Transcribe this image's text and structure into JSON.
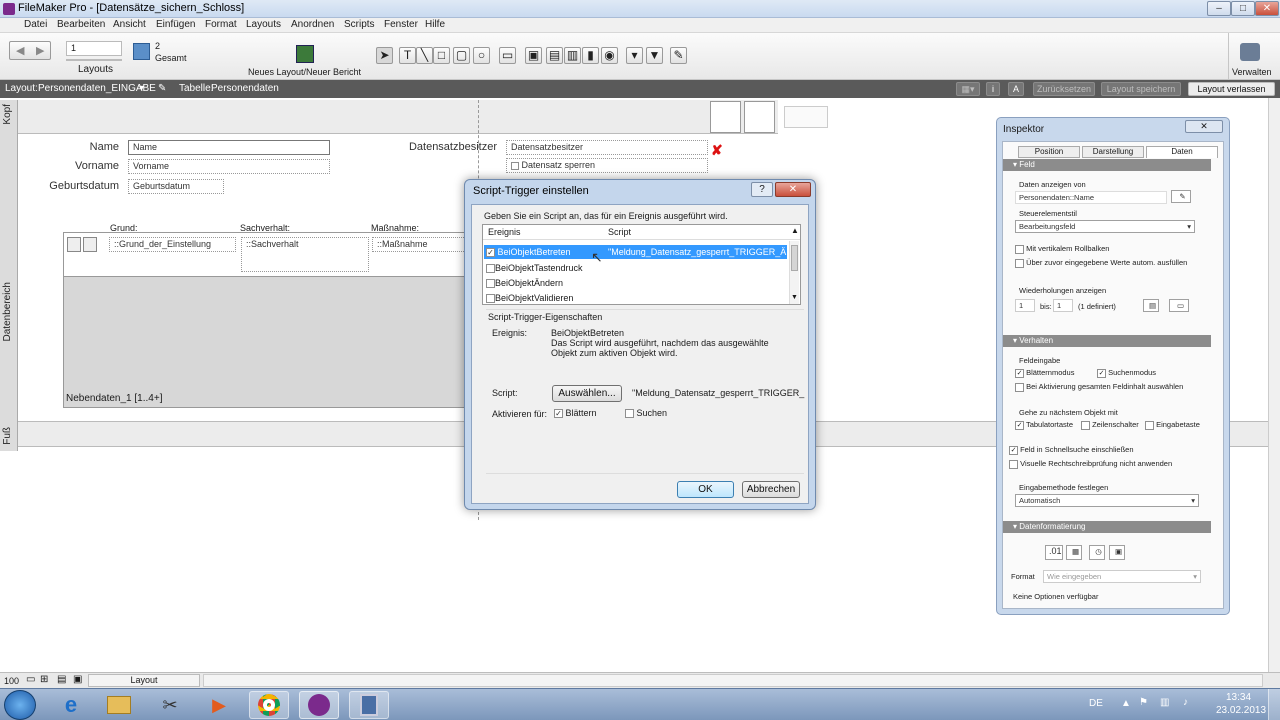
{
  "window": {
    "title": "FileMaker Pro - [Datensätze_sichern_Schloss]"
  },
  "menu": [
    "Datei",
    "Bearbeiten",
    "Ansicht",
    "Einfügen",
    "Format",
    "Layouts",
    "Anordnen",
    "Scripts",
    "Fenster",
    "Hilfe"
  ],
  "toolbar": {
    "record_number": "1",
    "total_count": "2",
    "total_label": "Gesamt",
    "layouts_label": "Layouts",
    "new_layout_label": "Neues Layout/Neuer Bericht",
    "manage_label": "Verwalten"
  },
  "layoutbar": {
    "layout_label": "Layout:",
    "layout_value": "Personendaten_EINGABE",
    "table_label": "Tabelle:",
    "table_value": "Personendaten",
    "reset_label": "Zurücksetzen",
    "save_label": "Layout speichern",
    "exit_label": "Layout verlassen"
  },
  "layout": {
    "bands": {
      "header": "Kopf",
      "body": "Datenbereich",
      "footer": "Fuß"
    },
    "labels": {
      "name": "Name",
      "vorname": "Vorname",
      "geburtsdatum": "Geburtsdatum",
      "besitzer": "Datensatzbesitzer",
      "grund": "Grund:",
      "sachverhalt": "Sachverhalt:",
      "massnahme": "Maßnahme:"
    },
    "fields": {
      "name": "Name",
      "vorname": "Vorname",
      "geburtsdatum": "Geburtsdatum",
      "besitzer": "Datensatzbesitzer",
      "sperren": "Datensatz sperren",
      "grund": "::Grund_der_Einstellung",
      "sachverhalt": "::Sachverhalt",
      "massnahme": "::Maßnahme"
    },
    "portal_label": "Nebendaten_1 [1..4+]"
  },
  "dialog": {
    "title": "Script-Trigger einstellen",
    "instruction": "Geben Sie ein Script an, das für ein Ereignis ausgeführt wird.",
    "col_event": "Ereignis",
    "col_script": "Script",
    "events": [
      {
        "name": "BeiObjektBetreten",
        "checked": true,
        "selected": true,
        "script": "\"Meldung_Datensatz_gesperrt_TRIGGER_Ä..."
      },
      {
        "name": "BeiObjektTastendruck",
        "checked": false,
        "selected": false,
        "script": ""
      },
      {
        "name": "BeiObjektÄndern",
        "checked": false,
        "selected": false,
        "script": ""
      },
      {
        "name": "BeiObjektValidieren",
        "checked": false,
        "selected": false,
        "script": ""
      }
    ],
    "props_title": "Script-Trigger-Eigenschaften",
    "event_label": "Ereignis:",
    "event_name": "BeiObjektBetreten",
    "event_desc_1": "Das Script wird ausgeführt, nachdem das ausgewählte",
    "event_desc_2": "Objekt zum aktiven Objekt wird.",
    "script_label": "Script:",
    "choose_button": "Auswählen...",
    "script_value": "\"Meldung_Datensatz_gesperrt_TRIGGER_",
    "activate_label": "Aktivieren für:",
    "browse_label": "Blättern",
    "browse_checked": true,
    "find_label": "Suchen",
    "find_checked": false,
    "ok": "OK",
    "cancel": "Abbrechen"
  },
  "inspector": {
    "title": "Inspektor",
    "tabs": [
      "Position",
      "Darstellung",
      "Daten"
    ],
    "sec_field": "Feld",
    "show_data_from": "Daten anzeigen von",
    "source_value": "Personendaten::Name",
    "control_style": "Steuerelementstil",
    "control_value": "Bearbeitungsfeld",
    "scrollbar": "Mit vertikalem Rollbalken",
    "autocomplete": "Über zuvor eingegebene Werte autom. ausfüllen",
    "repetitions": "Wiederholungen anzeigen",
    "rep_from": "1",
    "rep_to_label": "bis:",
    "rep_to": "1",
    "rep_defined": "(1 definiert)",
    "sec_behavior": "Verhalten",
    "field_entry": "Feldeingabe",
    "browse_mode": "Blätternmodus",
    "find_mode": "Suchenmodus",
    "select_all": "Bei Aktivierung gesamten Feldinhalt auswählen",
    "next_object": "Gehe zu nächstem Objekt mit",
    "tab_key": "Tabulatortaste",
    "return_key": "Zeilenschalter",
    "enter_key": "Eingabetaste",
    "quickfind": "Feld in Schnellsuche einschließen",
    "spellcheck": "Visuelle Rechtschreibprüfung nicht anwenden",
    "input_method": "Eingabemethode festlegen",
    "input_method_value": "Automatisch",
    "sec_format": "Datenformatierung",
    "format_label": "Format",
    "format_value": "Wie eingegeben",
    "no_options": "Keine Optionen verfügbar"
  },
  "status": {
    "zoom": "100",
    "mode": "Layout"
  },
  "taskbar": {
    "lang": "DE",
    "time": "13:34",
    "date": "23.02.2013"
  }
}
